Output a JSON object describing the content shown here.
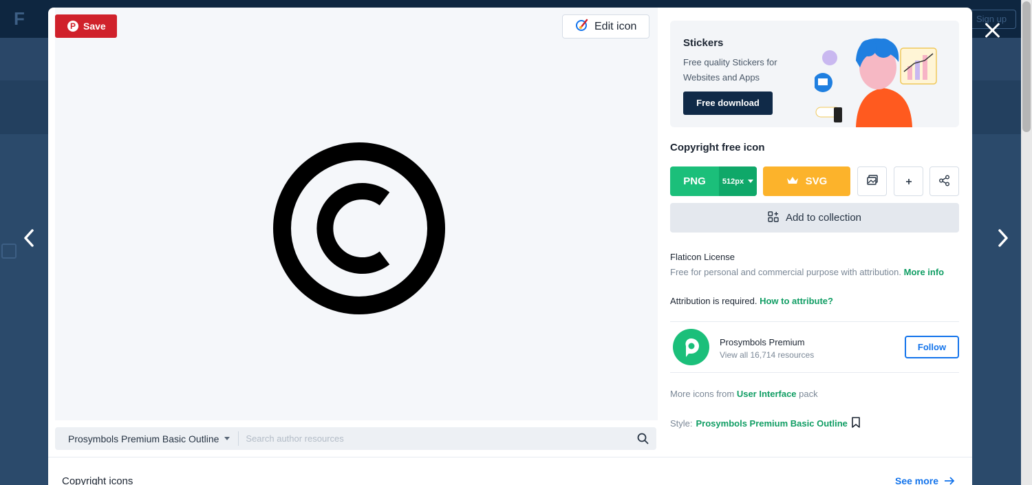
{
  "background": {
    "logo_text": "F",
    "signup_label": "Sign up"
  },
  "modal": {
    "save_label": "Save",
    "edit_label": "Edit icon",
    "preview_icon": "copyright-icon",
    "author_select_label": "Prosymbols Premium Basic Outline",
    "author_search_placeholder": "Search author resources",
    "related_title": "Copyright icons",
    "see_more_label": "See more",
    "promo": {
      "title": "Stickers",
      "description": "Free quality Stickers for Websites and Apps",
      "button_label": "Free download"
    },
    "icon_title": "Copyright free icon",
    "download": {
      "png_label": "PNG",
      "png_size": "512px",
      "svg_label": "SVG"
    },
    "add_to_collection_label": "Add to collection",
    "license": {
      "title": "Flaticon License",
      "text": "Free for personal and commercial purpose with attribution.",
      "more_info": "More info",
      "attribution": "Attribution is required.",
      "how_to": "How to attribute?"
    },
    "author": {
      "name": "Prosymbols Premium",
      "resources": "View all 16,714 resources",
      "follow_label": "Follow"
    },
    "pack": {
      "prefix": "More icons from",
      "name": "User Interface",
      "suffix": "pack"
    },
    "style": {
      "prefix": "Style:",
      "name": "Prosymbols Premium Basic Outline"
    }
  },
  "colors": {
    "save_red": "#d0212b",
    "png_green": "#1bbf7a",
    "svg_orange": "#fcb32b",
    "link_green": "#0f9d63",
    "follow_blue": "#1273eb"
  }
}
